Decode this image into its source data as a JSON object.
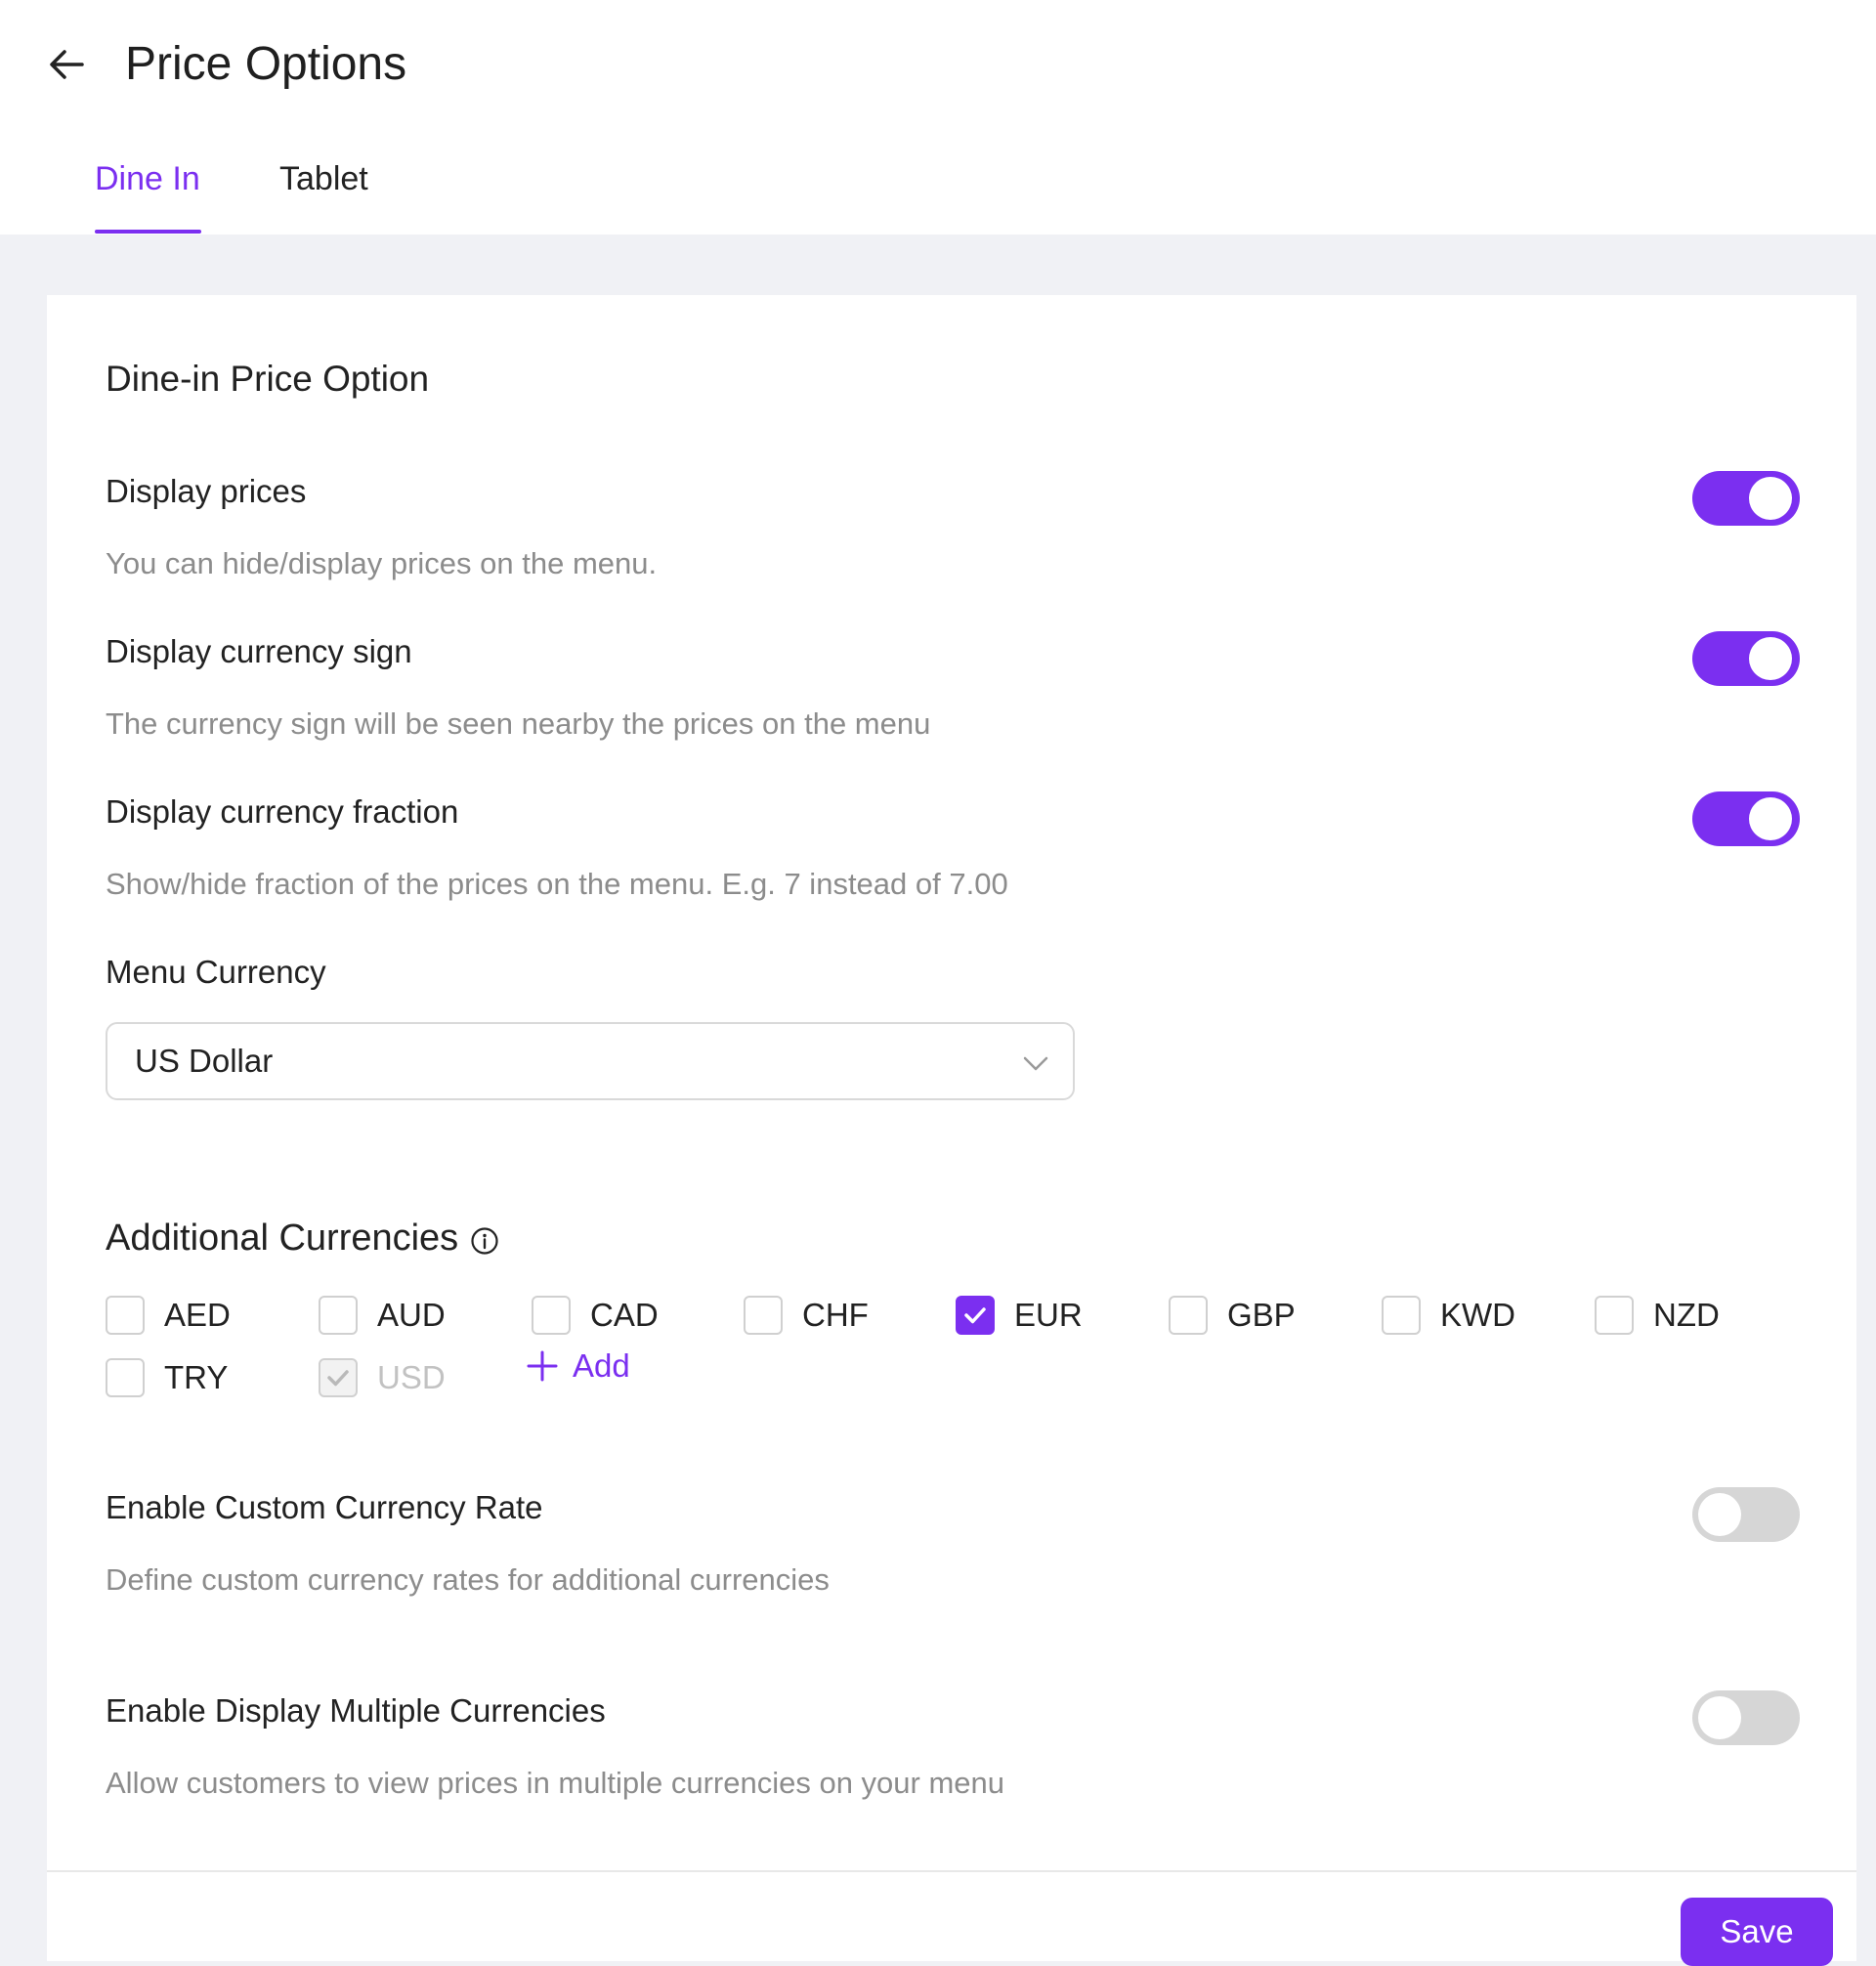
{
  "header": {
    "title": "Price Options",
    "back_icon": "arrow-left-icon",
    "tabs": [
      {
        "label": "Dine In",
        "active": true
      },
      {
        "label": "Tablet",
        "active": false
      }
    ]
  },
  "card": {
    "section_title": "Dine-in Price Option",
    "settings": [
      {
        "label": "Display prices",
        "desc": "You can hide/display prices on the menu.",
        "enabled": true
      },
      {
        "label": "Display currency sign",
        "desc": "The currency sign will be seen nearby the prices on the menu",
        "enabled": true
      },
      {
        "label": "Display currency fraction",
        "desc": "Show/hide fraction of the prices on the menu. E.g. 7 instead of 7.00",
        "enabled": true
      }
    ],
    "menu_currency": {
      "label": "Menu Currency",
      "selected": "US Dollar",
      "chevron_icon": "chevron-down-icon"
    },
    "additional_currencies": {
      "title": "Additional Currencies",
      "info_icon": "info-icon",
      "items": [
        {
          "code": "AED",
          "checked": false,
          "disabled": false
        },
        {
          "code": "AUD",
          "checked": false,
          "disabled": false
        },
        {
          "code": "CAD",
          "checked": false,
          "disabled": false
        },
        {
          "code": "CHF",
          "checked": false,
          "disabled": false
        },
        {
          "code": "EUR",
          "checked": true,
          "disabled": false
        },
        {
          "code": "GBP",
          "checked": false,
          "disabled": false
        },
        {
          "code": "KWD",
          "checked": false,
          "disabled": false
        },
        {
          "code": "NZD",
          "checked": false,
          "disabled": false
        },
        {
          "code": "TRY",
          "checked": false,
          "disabled": false
        },
        {
          "code": "USD",
          "checked": true,
          "disabled": true
        }
      ],
      "add_label": "Add",
      "add_icon": "plus-icon"
    },
    "advanced": [
      {
        "label": "Enable Custom Currency Rate",
        "desc": "Define custom currency rates for additional currencies",
        "enabled": false
      },
      {
        "label": "Enable Display Multiple Currencies",
        "desc": "Allow customers to view prices in multiple currencies on your menu",
        "enabled": false
      }
    ],
    "save_label": "Save"
  },
  "colors": {
    "accent": "#7b2ff0",
    "toggle_off": "#d6d6d6",
    "muted_text": "#8c8c8c",
    "page_bg": "#f0f1f5"
  }
}
